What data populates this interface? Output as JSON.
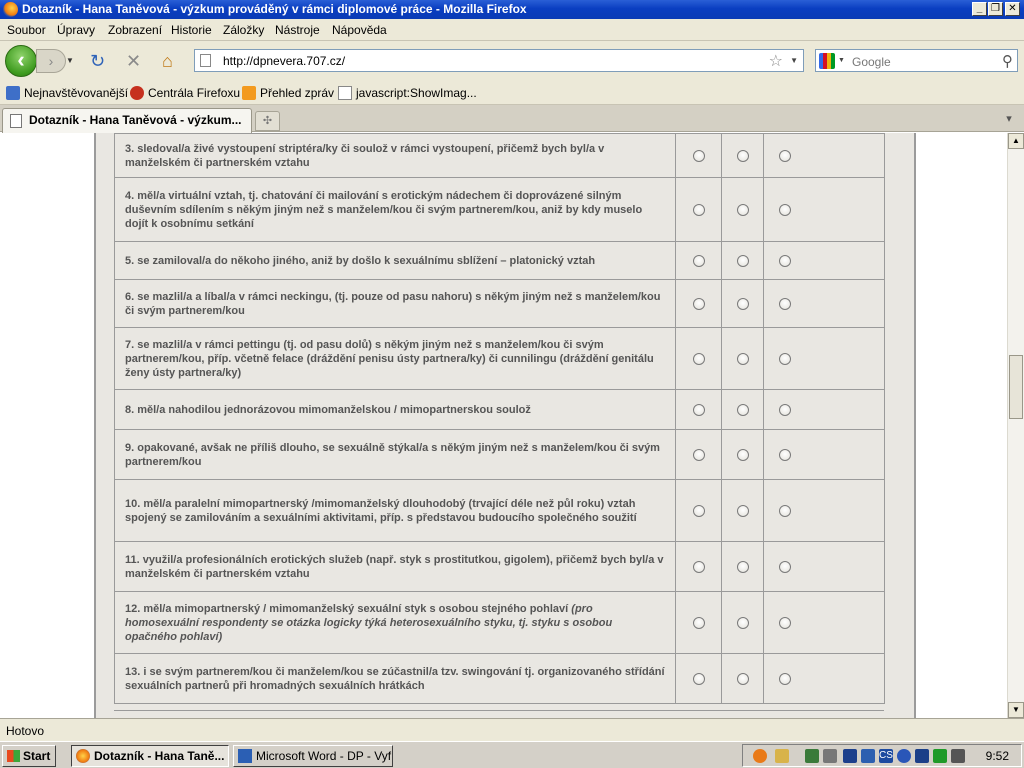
{
  "window": {
    "title": "Dotazník - Hana Taněvová - výzkum prováděný v rámci diplomové práce - Mozilla Firefox"
  },
  "menu": [
    "Soubor",
    "Úpravy",
    "Zobrazení",
    "Historie",
    "Záložky",
    "Nástroje",
    "Nápověda"
  ],
  "nav": {
    "url": "http://dpnevera.707.cz/",
    "search_placeholder": "Google"
  },
  "bookmarks": [
    "Nejnavštěvovanější",
    "Centrála Firefoxu",
    "Přehled zpráv",
    "javascript:ShowImag..."
  ],
  "tab": {
    "label": "Dotazník - Hana Taněvová - výzkum..."
  },
  "questions": [
    {
      "text": "3. sledoval/a živé vystoupení striptéra/ky či soulož v rámci vystoupení, přičemž bych byl/a v manželském či partnerském vztahu"
    },
    {
      "text": "4. měl/a virtuální vztah, tj. chatování či mailování s erotickým nádechem či doprovázené silným duševním sdílením s někým jiným než s manželem/kou či svým partnerem/kou, aniž by kdy muselo dojít k osobnímu setkání"
    },
    {
      "text": "5. se zamiloval/a do někoho jiného, aniž by došlo k sexuálnímu sblížení – platonický vztah"
    },
    {
      "text": "6. se mazlil/a a líbal/a v rámci neckingu, (tj. pouze od pasu nahoru) s někým jiným než s manželem/kou či svým partnerem/kou"
    },
    {
      "text": "7. se mazlil/a v rámci pettingu (tj. od pasu dolů) s někým jiným než s manželem/kou či svým partnerem/kou, příp. včetně felace (dráždění penisu ústy partnera/ky) či cunnilingu (dráždění genitálu ženy ústy partnera/ky)"
    },
    {
      "text": "8. měl/a nahodilou jednorázovou mimomanželskou / mimopartnerskou soulož"
    },
    {
      "text": "9. opakované, avšak ne příliš dlouho, se sexuálně stýkal/a s někým jiným než s manželem/kou či svým partnerem/kou"
    },
    {
      "text": "10. měl/a paralelní mimopartnerský /mimomanželský dlouhodobý (trvající déle než půl roku) vztah spojený se zamilováním a sexuálními aktivitami, příp. s představou budoucího společného soužití"
    },
    {
      "text": "11. využil/a profesionálních erotických služeb (např. styk s prostitutkou, gigolem), přičemž bych byl/a v manželském či partnerském vztahu"
    },
    {
      "text": "12. měl/a mimopartnerský / mimomanželský sexuální styk s osobou stejného pohlaví",
      "note": "(pro homosexuální respondenty se otázka logicky týká heterosexuálního styku, tj. styku s osobou opačného pohlaví)"
    },
    {
      "text": "13. i se svým partnerem/kou či manželem/kou se zúčastnil/a tzv. swingování tj. organizovaného střídání sexuálních partnerů při hromadných sexuálních hrátkách"
    }
  ],
  "status": {
    "text": "Hotovo"
  },
  "taskbar": {
    "start": "Start",
    "tasks": [
      "Dotazník - Hana Taně...",
      "Microsoft Word - DP - Vyf..."
    ],
    "clock": "9:52"
  }
}
